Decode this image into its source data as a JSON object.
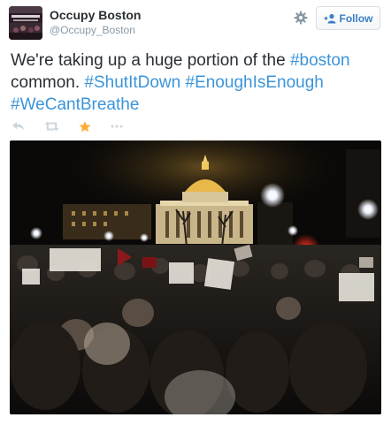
{
  "user": {
    "display_name": "Occupy Boston",
    "handle": "@Occupy_Boston"
  },
  "follow_label": "Follow",
  "tweet": {
    "segments": [
      {
        "text": "We're taking up a huge portion of the ",
        "type": "text"
      },
      {
        "text": "#boston",
        "type": "hashtag"
      },
      {
        "text": " common. ",
        "type": "text"
      },
      {
        "text": "#ShutItDown",
        "type": "hashtag"
      },
      {
        "text": " ",
        "type": "text"
      },
      {
        "text": "#EnoughIsEnough",
        "type": "hashtag"
      },
      {
        "text": " ",
        "type": "text"
      },
      {
        "text": "#WeCantBreathe",
        "type": "hashtag"
      }
    ]
  },
  "actions": {
    "icons": [
      "reply-icon",
      "retweet-icon",
      "favorite-icon",
      "more-icon"
    ]
  },
  "colors": {
    "hashtag": "#3b94d9",
    "favorite": "#ffac33",
    "action_gray": "#ccd6dd",
    "follow_text": "#3a7fc4"
  }
}
